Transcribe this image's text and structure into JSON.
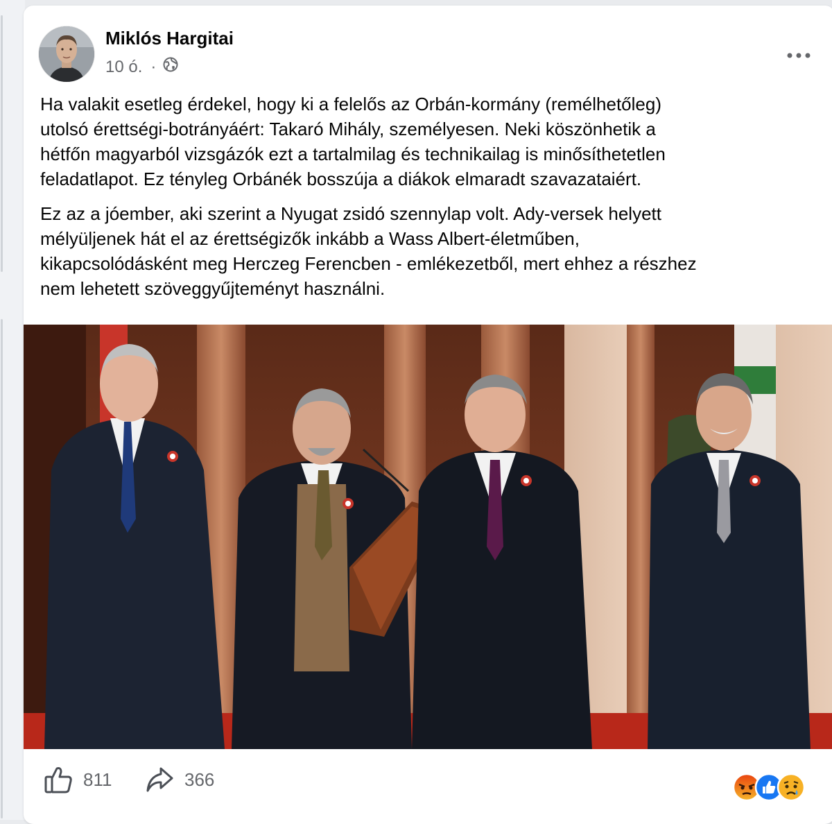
{
  "post": {
    "author_name": "Miklós Hargitai",
    "timestamp": "10 ó.",
    "separator": "·",
    "audience_icon": "globe-icon",
    "more_icon": "more-horizontal-icon",
    "paragraphs": [
      "Ha valakit esetleg érdekel, hogy ki a felelős az Orbán-kormány (remélhetőleg)\nutolsó érettségi-botrányáért: Takaró Mihály, személyesen. Neki köszönhetik a\nhétfőn magyarból vizsgázók ezt a tartalmilag és technikailag is minősíthetetlen\nfeladatlapot. Ez tényleg Orbánék bosszúja a diákok elmaradt szavazataiért.",
      "Ez az a jóember, aki szerint a Nyugat zsidó szennylap volt. Ady-versek helyett\nmélyüljenek hát el az érettségizők inkább a Wass Albert-életműben,\nkikapcsolódásként meg Herczeg Ferencben - emlékezetből, mert ehhez a részhez\nnem lehetett szöveggyűjteményt használni."
    ]
  },
  "footer": {
    "like_count": "811",
    "share_count": "366",
    "like_icon": "thumbs-up-icon",
    "share_icon": "share-arrow-icon",
    "reaction_icons": [
      "angry-reaction-icon",
      "like-reaction-icon",
      "sad-reaction-icon"
    ]
  },
  "colors": {
    "text_primary": "#050505",
    "text_secondary": "#65676b",
    "like_blue": "#1877f2",
    "angry_orange": "#e9710f",
    "sad_yellow": "#f7b125"
  }
}
